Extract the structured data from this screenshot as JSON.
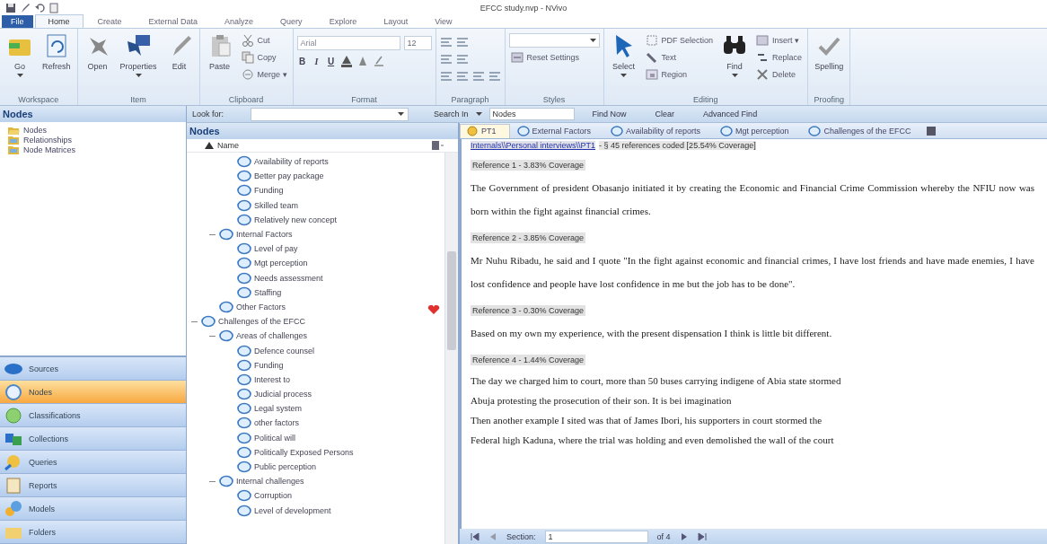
{
  "window": {
    "title": "EFCC study.nvp - NVivo"
  },
  "ribbon_tabs": [
    {
      "label": "File",
      "selected": false,
      "kind": "file"
    },
    {
      "label": "Home",
      "selected": true,
      "kind": "tab"
    },
    {
      "label": "Create",
      "selected": false,
      "kind": "tab"
    },
    {
      "label": "External Data",
      "selected": false,
      "kind": "tab"
    },
    {
      "label": "Analyze",
      "selected": false,
      "kind": "tab"
    },
    {
      "label": "Query",
      "selected": false,
      "kind": "tab"
    },
    {
      "label": "Explore",
      "selected": false,
      "kind": "tab"
    },
    {
      "label": "Layout",
      "selected": false,
      "kind": "tab"
    },
    {
      "label": "View",
      "selected": false,
      "kind": "tab"
    }
  ],
  "ribbon_groups": [
    {
      "label": "Workspace",
      "controls": [
        {
          "kind": "large",
          "label": "Go",
          "dropdown": true
        },
        {
          "kind": "large",
          "label": "Refresh",
          "dropdown": false
        }
      ]
    },
    {
      "label": "Item",
      "controls": [
        {
          "kind": "large",
          "label": "Open",
          "dropdown": false
        },
        {
          "kind": "large",
          "label": "Properties",
          "dropdown": true
        },
        {
          "kind": "large",
          "label": "Edit",
          "dropdown": false
        }
      ]
    },
    {
      "label": "Clipboard",
      "controls": [
        {
          "kind": "large",
          "label": "Paste",
          "dropdown": false
        },
        {
          "kind": "stack",
          "items": [
            {
              "label": "Cut"
            },
            {
              "label": "Copy"
            },
            {
              "label": "Merge ▾"
            }
          ]
        }
      ]
    },
    {
      "label": "Format",
      "controls": [
        {
          "kind": "format",
          "font": "Arial",
          "size": "12",
          "buttons": [
            "B",
            "I",
            "U"
          ]
        }
      ]
    },
    {
      "label": "Paragraph",
      "controls": [
        {
          "kind": "paragraph"
        }
      ]
    },
    {
      "label": "Styles",
      "controls": [
        {
          "kind": "styles",
          "items": [
            {
              "label": "Reset Settings"
            }
          ]
        }
      ]
    },
    {
      "label": "Editing",
      "controls": [
        {
          "kind": "large",
          "label": "Select",
          "dropdown": true
        },
        {
          "kind": "stack",
          "items": [
            {
              "label": "PDF Selection"
            },
            {
              "label": "Text"
            },
            {
              "label": "Region"
            }
          ]
        },
        {
          "kind": "large",
          "label": "Find",
          "dropdown": true
        },
        {
          "kind": "stack",
          "items": [
            {
              "label": "Insert ▾"
            },
            {
              "label": "Replace"
            },
            {
              "label": "Delete"
            }
          ]
        }
      ]
    },
    {
      "label": "Proofing",
      "controls": [
        {
          "kind": "large",
          "label": "Spelling",
          "dropdown": false
        }
      ]
    }
  ],
  "navigation": {
    "title": "Nodes",
    "folders": [
      {
        "label": "Nodes"
      },
      {
        "label": "Relationships"
      },
      {
        "label": "Node Matrices"
      }
    ],
    "buttons": [
      {
        "label": "Sources",
        "selected": false
      },
      {
        "label": "Nodes",
        "selected": true
      },
      {
        "label": "Classifications",
        "selected": false
      },
      {
        "label": "Collections",
        "selected": false
      },
      {
        "label": "Queries",
        "selected": false
      },
      {
        "label": "Reports",
        "selected": false
      },
      {
        "label": "Models",
        "selected": false
      },
      {
        "label": "Folders",
        "selected": false
      }
    ]
  },
  "find_bar": {
    "look_for_label": "Look for:",
    "search_in_label": "Search In",
    "search_in_value": "Nodes",
    "buttons": [
      "Find Now",
      "Clear",
      "Advanced Find"
    ]
  },
  "node_list": {
    "title": "Nodes",
    "column": "Name",
    "tree": [
      {
        "children": [
          {
            "children": [
              {
                "label": "Availability of reports"
              },
              {
                "label": "Better pay package"
              },
              {
                "label": "Funding"
              },
              {
                "label": "Skilled team"
              },
              {
                "label": "Relatively new concept"
              }
            ]
          },
          {
            "label": "Internal Factors",
            "expanded": true,
            "children": [
              {
                "label": "Level of pay"
              },
              {
                "label": "Mgt perception"
              },
              {
                "label": "Needs assessment"
              },
              {
                "label": "Staffing"
              }
            ]
          },
          {
            "label": "Other Factors"
          }
        ]
      },
      {
        "label": "Challenges of the EFCC",
        "expanded": true,
        "children": [
          {
            "label": "Areas of challenges",
            "expanded": true,
            "children": [
              {
                "label": "Defence counsel"
              },
              {
                "label": "Funding"
              },
              {
                "label": "Interest to"
              },
              {
                "label": "Judicial process"
              },
              {
                "label": "Legal system"
              },
              {
                "label": "other factors"
              },
              {
                "label": "Political will"
              },
              {
                "label": "Politically Exposed Persons"
              },
              {
                "label": "Public perception"
              }
            ]
          },
          {
            "label": "Internal challenges",
            "expanded": true,
            "children": [
              {
                "label": "Corruption"
              },
              {
                "label": "Level of development"
              }
            ]
          }
        ]
      }
    ]
  },
  "detail": {
    "tabs": [
      {
        "label": "PT1",
        "kind": "source",
        "selected": true
      },
      {
        "label": "External Factors",
        "kind": "node",
        "selected": false
      },
      {
        "label": "Availability of reports",
        "kind": "node",
        "selected": false
      },
      {
        "label": "Mgt perception",
        "kind": "node",
        "selected": false
      },
      {
        "label": "Challenges of the EFCC",
        "kind": "node",
        "selected": false
      }
    ],
    "source_link": "Internals\\\\Personal interviews\\\\PT1",
    "summary": "- § 45 references coded  [25.54% Coverage]",
    "blocks": [
      {
        "kind": "reference",
        "text": "Reference 1 - 3.83% Coverage"
      },
      {
        "kind": "paragraph",
        "text": "The Government of president Obasanjo initiated it by creating the Economic and Financial Crime Commission whereby the NFIU now was born within the fight against financial crimes."
      },
      {
        "kind": "reference",
        "text": "Reference 2 - 3.85% Coverage"
      },
      {
        "kind": "paragraph",
        "text": "Mr Nuhu Ribadu, he said and I quote \"In the fight against economic and financial crimes, I have lost friends and have made enemies, I have lost confidence and people have lost confidence in me but the job has to be done\"."
      },
      {
        "kind": "reference",
        "text": "Reference 3 - 0.30% Coverage"
      },
      {
        "kind": "paragraph",
        "text": "Based on my own my experience, with the present dispensation I think is little bit different."
      },
      {
        "kind": "reference",
        "text": "Reference 4 - 1.44% Coverage"
      },
      {
        "kind": "line",
        "text": "The day we charged him to court, more than 50 buses carrying indigene of Abia state stormed"
      },
      {
        "kind": "line",
        "text": "Abuja protesting the prosecution of their son. It is bei imagination"
      },
      {
        "kind": "line",
        "text": "Then another example I sited was that of James Ibori, his supporters in court stormed the"
      },
      {
        "kind": "line",
        "text": "Federal high Kaduna, where the trial was holding and even demolished the wall of the court"
      }
    ],
    "pager": {
      "label": "Section:",
      "value": "1",
      "total": "of 4"
    }
  }
}
